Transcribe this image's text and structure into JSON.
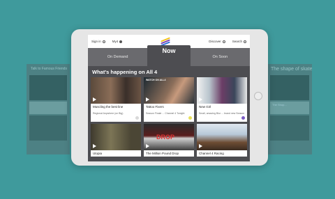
{
  "background_color": "#3f9a9c",
  "ghost_left": {
    "title": "Talk to Famous Friends",
    "meta": ""
  },
  "ghost_right": {
    "title": "The shape of skate",
    "meta": "The Shop..."
  },
  "topbar": {
    "sign_in": "Sign in",
    "my4": "My4",
    "logo": "channel-4-logo",
    "discover": "Discover",
    "search": "Search"
  },
  "tabs": {
    "on_demand": "On Demand",
    "now": "Now",
    "on_soon": "On Soon"
  },
  "section_title": "What's happening on All 4",
  "cards": [
    {
      "title": "Muscling the best line",
      "subtitle": "Regional Anywhere (on Big)",
      "thumb_label": "",
      "mark_color": "#d9d9d9"
    },
    {
      "title": "Tattoo Fixers",
      "subtitle": "Season Finale ... Channel 4 Tonight",
      "thumb_label": "WATCH ON ALL4",
      "mark_color": "#e8e05a"
    },
    {
      "title": "New Girl",
      "subtitle": "Small, amazing Blur ... brand new Season",
      "thumb_label": "",
      "mark_color": "#7b5cc4"
    },
    {
      "title": "Utopia",
      "subtitle": "",
      "thumb_label": "",
      "mark_color": "#d9d9d9"
    },
    {
      "title": "The Million Pound Drop",
      "subtitle": "",
      "thumb_label": "DROP",
      "mark_color": "#d9d9d9"
    },
    {
      "title": "Channel 4 Racing",
      "subtitle": "",
      "thumb_label": "",
      "mark_color": "#d9d9d9"
    }
  ]
}
